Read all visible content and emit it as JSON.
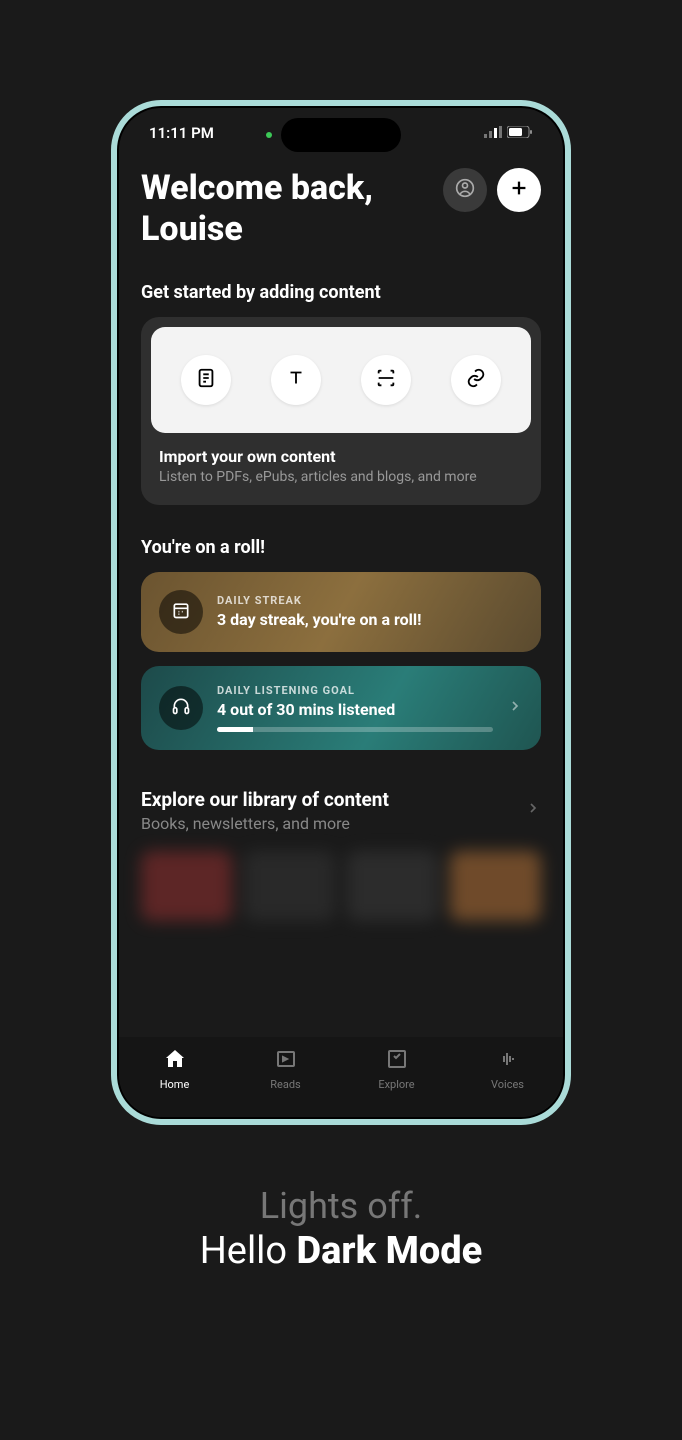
{
  "status": {
    "time": "11:11 PM"
  },
  "header": {
    "welcome_line1": "Welcome back,",
    "welcome_name": "Louise"
  },
  "get_started_title": "Get started by adding content",
  "import": {
    "title": "Import your own content",
    "subtitle": "Listen to PDFs, ePubs, articles and blogs, and more",
    "icons": [
      "document-icon",
      "text-icon",
      "scan-icon",
      "link-icon"
    ]
  },
  "roll_title": "You're on a roll!",
  "streak": {
    "label": "DAILY STREAK",
    "value": "3 day streak, you're on a roll!"
  },
  "goal": {
    "label": "DAILY LISTENING GOAL",
    "value": "4 out of 30 mins listened",
    "progress_percent": 13
  },
  "explore": {
    "title": "Explore our library of content",
    "subtitle": "Books, newsletters, and more"
  },
  "tabs": [
    {
      "label": "Home",
      "active": true
    },
    {
      "label": "Reads",
      "active": false
    },
    {
      "label": "Explore",
      "active": false
    },
    {
      "label": "Voices",
      "active": false
    }
  ],
  "promo": {
    "line1": "Lights off.",
    "line2_prefix": "Hello ",
    "line2_bold": "Dark Mode"
  }
}
